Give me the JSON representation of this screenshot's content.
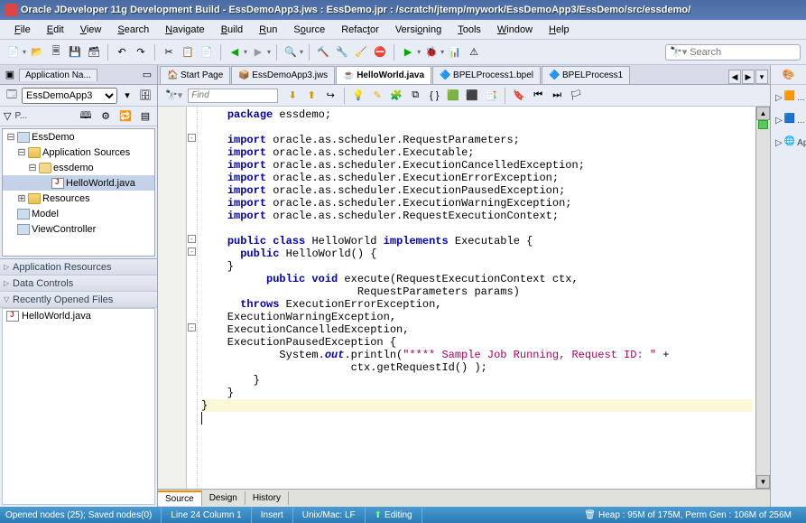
{
  "window": {
    "title": "Oracle JDeveloper 11g Development Build - EssDemoApp3.jws : EssDemo.jpr : /scratch/jtemp/mywork/EssDemoApp3/EssDemo/src/essdemo/"
  },
  "menu": [
    "File",
    "Edit",
    "View",
    "Search",
    "Navigate",
    "Build",
    "Run",
    "Source",
    "Refactor",
    "Versioning",
    "Tools",
    "Window",
    "Help"
  ],
  "search": {
    "placeholder": "Search"
  },
  "app_nav": {
    "tab_label": "Application Na...",
    "project_select": "EssDemoApp3",
    "section_label": "P...",
    "tree": [
      {
        "label": "EssDemo",
        "icon": "proj",
        "indent": 0,
        "expand": "-"
      },
      {
        "label": "Application Sources",
        "icon": "folder",
        "indent": 1,
        "expand": "-"
      },
      {
        "label": "essdemo",
        "icon": "pkg",
        "indent": 2,
        "expand": "-"
      },
      {
        "label": "HelloWorld.java",
        "icon": "java",
        "indent": 3,
        "expand": "",
        "selected": true
      },
      {
        "label": "Resources",
        "icon": "folder",
        "indent": 1,
        "expand": "+"
      },
      {
        "label": "Model",
        "icon": "proj",
        "indent": 0,
        "expand": ""
      },
      {
        "label": "ViewController",
        "icon": "proj",
        "indent": 0,
        "expand": ""
      }
    ],
    "accordions": [
      "Application Resources",
      "Data Controls",
      "Recently Opened Files"
    ],
    "recent_file": "HelloWorld.java"
  },
  "tabs": [
    {
      "label": "Start Page",
      "icon": "start"
    },
    {
      "label": "EssDemoApp3.jws",
      "icon": "jws"
    },
    {
      "label": "HelloWorld.java",
      "icon": "java",
      "active": true
    },
    {
      "label": "BPELProcess1.bpel",
      "icon": "bpel"
    },
    {
      "label": "BPELProcess1",
      "icon": "bpel"
    }
  ],
  "find": {
    "placeholder": "Find"
  },
  "code": {
    "l1": "package",
    "l1b": " essdemo;",
    "imp": "import",
    "i1": " oracle.as.scheduler.RequestParameters;",
    "i2": " oracle.as.scheduler.Executable;",
    "i3": " oracle.as.scheduler.ExecutionCancelledException;",
    "i4": " oracle.as.scheduler.ExecutionErrorException;",
    "i5": " oracle.as.scheduler.ExecutionPausedException;",
    "i6": " oracle.as.scheduler.ExecutionWarningException;",
    "i7": " oracle.as.scheduler.RequestExecutionContext;",
    "pub": "public",
    "cls": "class",
    "hw": " HelloWorld ",
    "impl": "implements",
    "exec": " Executable {",
    "phw": " HelloWorld() {",
    "cbr": "    }",
    "pv": "public void",
    "execm": " execute(RequestExecutionContext ctx,",
    "params": "                        RequestParameters params)",
    "thr": "throws",
    "ee": " ExecutionErrorException,",
    "ew": "    ExecutionWarningException,",
    "ec": "    ExecutionCancelledException,",
    "ep": "    ExecutionPausedException {",
    "sout": "            System.",
    "out": "out",
    "pln": ".println(",
    "str": "\"**** Sample Job Running, Request ID: \"",
    "plus": " +",
    "ctx": "                       ctx.getRequestId() );",
    "cb1": "        }",
    "cb2": "    }",
    "cb3": "}"
  },
  "editor_bottom_tabs": [
    "Source",
    "Design",
    "History"
  ],
  "right_rail": [
    {
      "label": "...",
      "icon": "orange"
    },
    {
      "label": "...",
      "icon": "blue"
    },
    {
      "label": "Ap",
      "icon": "globe"
    }
  ],
  "status": {
    "opened": "Opened nodes (25); Saved nodes(0)",
    "line": "Line 24 Column 1",
    "insert": "Insert",
    "unix": "Unix/Mac: LF",
    "editing": "Editing",
    "heap": "Heap : 95M of 175M, Perm Gen : 106M of 256M"
  }
}
